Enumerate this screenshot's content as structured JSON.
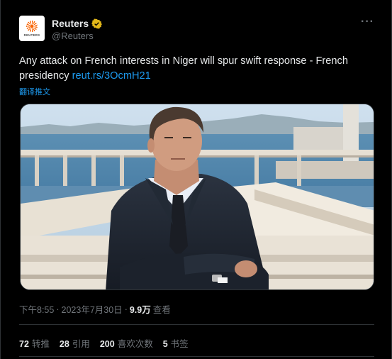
{
  "author": {
    "display_name": "Reuters",
    "handle": "@Reuters",
    "avatar_wordmark": "REUTERS"
  },
  "tweet": {
    "text": "Any attack on French interests in Niger will spur swift response - French presidency ",
    "link": "reut.rs/3OcmH21",
    "translate_label": "翻译推文"
  },
  "meta": {
    "time": "下午8:55",
    "separator": "·",
    "date": "2023年7月30日",
    "separator2": "·",
    "views_count": "9.9万",
    "views_label": "查看"
  },
  "stats": {
    "retweets_count": "72",
    "retweets_label": "转推",
    "quotes_count": "28",
    "quotes_label": "引用",
    "likes_count": "200",
    "likes_label": "喜欢次数",
    "bookmarks_count": "5",
    "bookmarks_label": "书签"
  },
  "icons": {
    "verified": "verified-badge-icon",
    "more": "more-horizontal-icon"
  },
  "colors": {
    "background": "#000000",
    "text": "#e7e9ea",
    "muted": "#71767b",
    "link": "#1d9bf0",
    "verified_gold": "#e2b719",
    "border": "#2f3336"
  }
}
